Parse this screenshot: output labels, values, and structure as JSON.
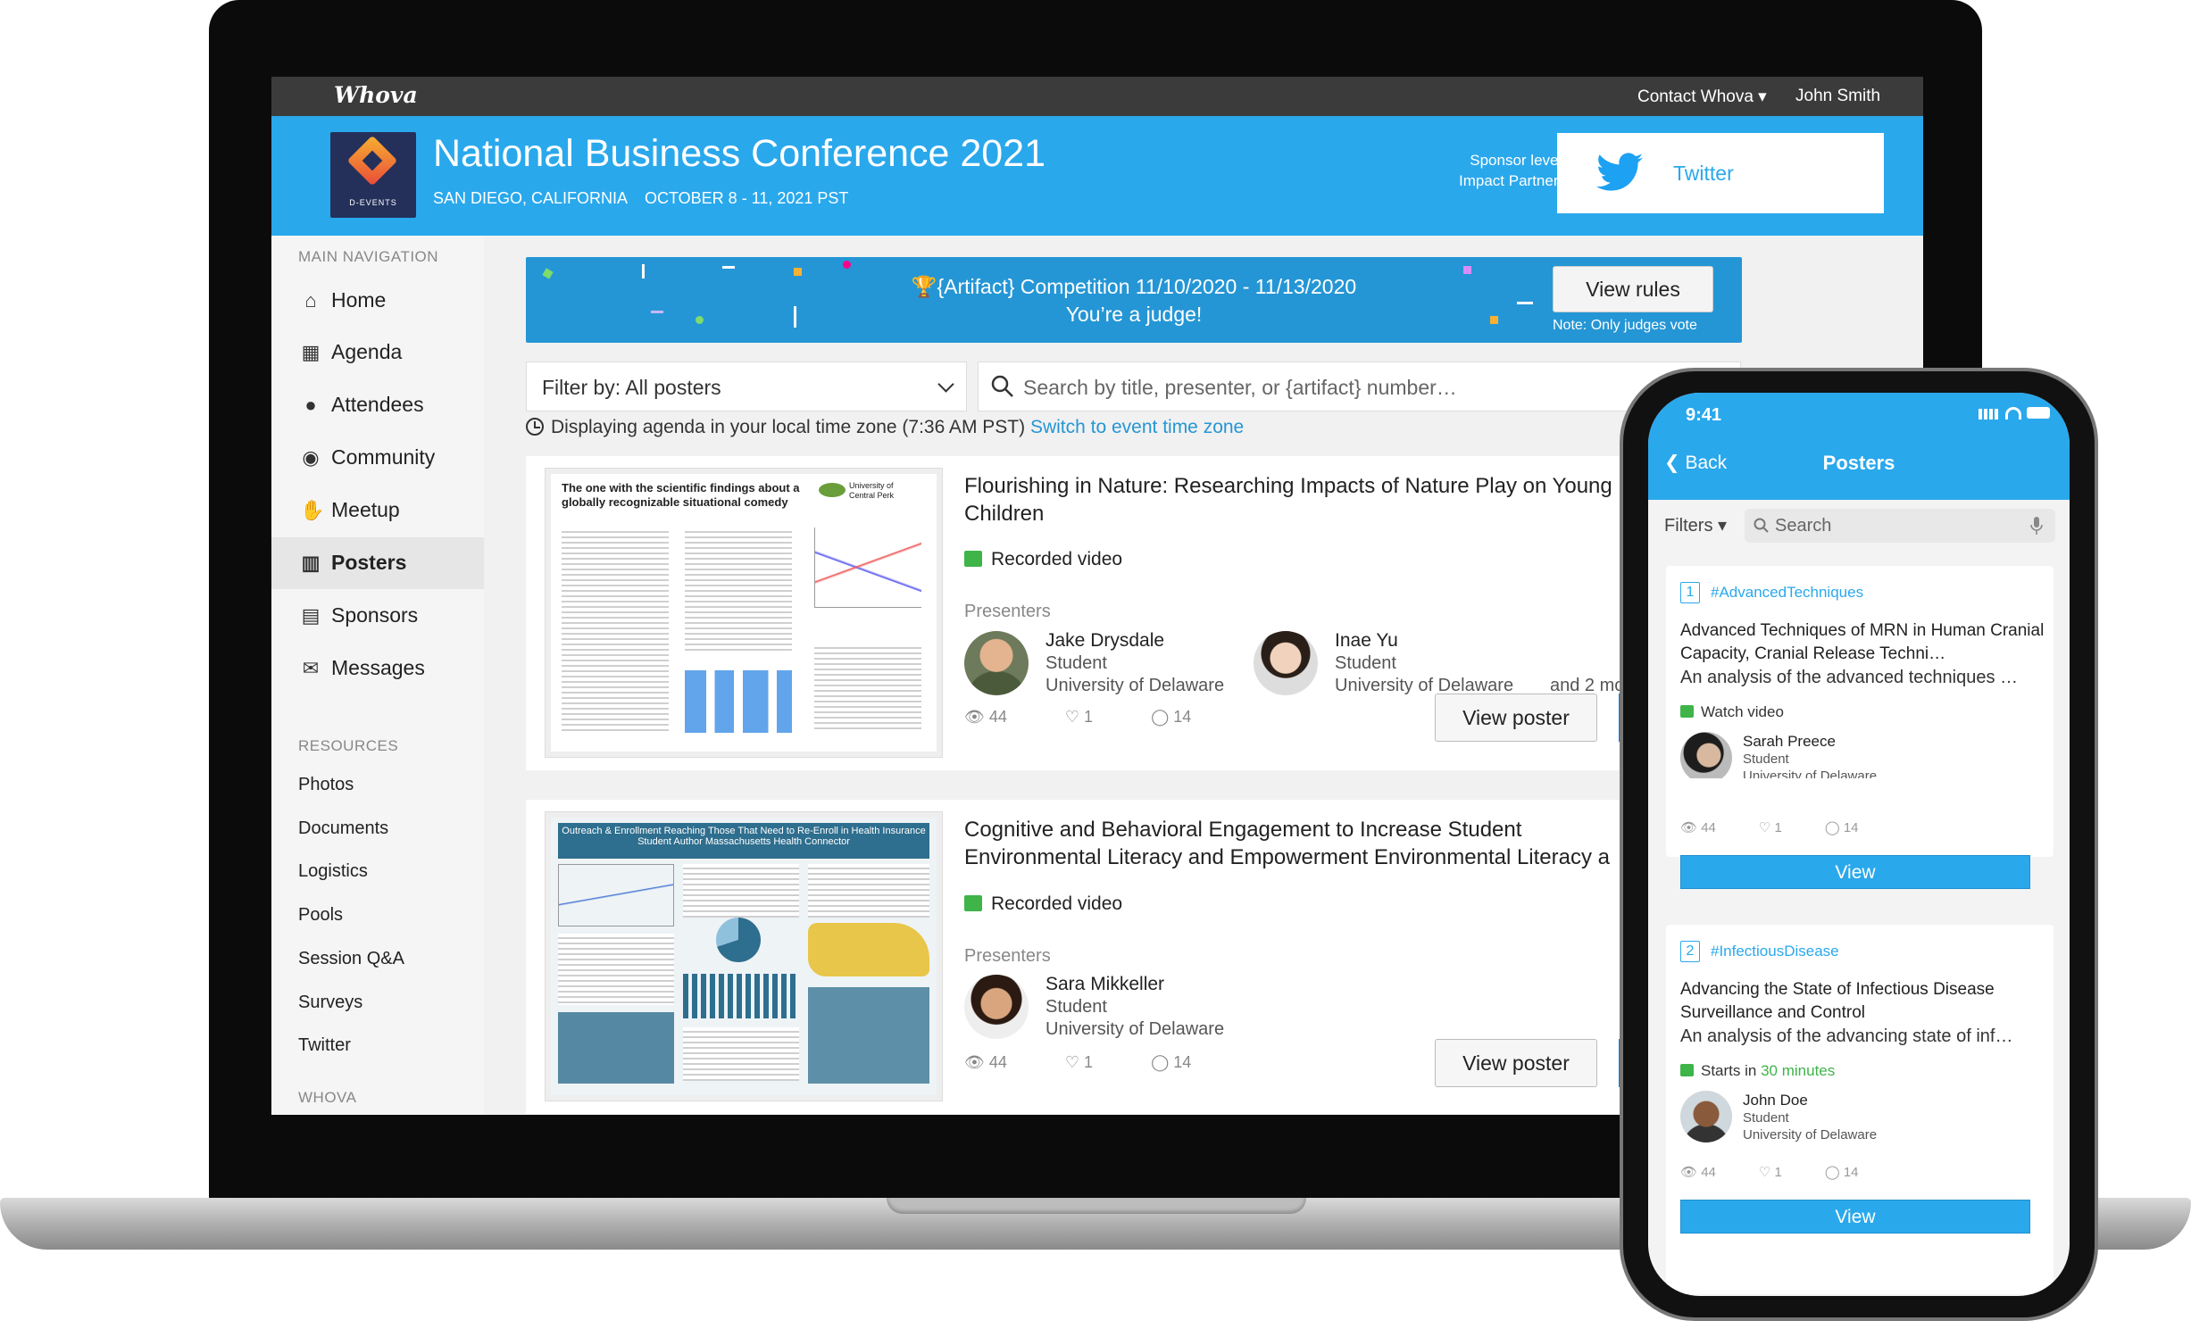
{
  "topbar": {
    "logo": "Whova",
    "contact": "Contact Whova ▾",
    "user": "John Smith"
  },
  "event": {
    "title": "National Business Conference 2021",
    "location": "SAN DIEGO, CALIFORNIA",
    "dates": "OCTOBER 8 - 11, 2021 PST",
    "logo_text": "D-EVENTS",
    "sponsor_label_1": "Sponsor level:",
    "sponsor_label_2": "Impact Partners",
    "sponsor_name": "Twitter"
  },
  "sidebar": {
    "main_heading": "MAIN NAVIGATION",
    "items": [
      {
        "label": "Home",
        "icon": "home-icon"
      },
      {
        "label": "Agenda",
        "icon": "calendar-icon"
      },
      {
        "label": "Attendees",
        "icon": "people-icon"
      },
      {
        "label": "Community",
        "icon": "chat-icon"
      },
      {
        "label": "Meetup",
        "icon": "handshake-icon"
      },
      {
        "label": "Posters",
        "icon": "building-icon"
      },
      {
        "label": "Sponsors",
        "icon": "building-icon"
      },
      {
        "label": "Messages",
        "icon": "envelope-icon"
      }
    ],
    "resources_heading": "RESOURCES",
    "resources": [
      "Photos",
      "Documents",
      "Logistics",
      "Pools",
      "Session Q&A",
      "Surveys",
      "Twitter"
    ],
    "footer_heading": "WHOVA"
  },
  "banner": {
    "line1": "🏆{Artifact} Competition 11/10/2020 - 11/13/2020",
    "line2": "You’re a judge!",
    "button": "View rules",
    "note": "Note: Only judges vote",
    "color": "#2596d5"
  },
  "filter": {
    "label": "Filter by: All posters"
  },
  "search": {
    "placeholder": "Search by title, presenter, or {artifact} number…"
  },
  "timezone": {
    "text": "Displaying agenda in your local time zone (7:36 AM PST)",
    "link": "Switch to event time zone"
  },
  "posters": [
    {
      "title_line1": "Flourishing in Nature: Researching Impacts of Nature Play on Young",
      "title_line2": "Children",
      "media": "Recorded video",
      "presenters_label": "Presenters",
      "presenters": [
        {
          "name": "Jake Drysdale",
          "role": "Student",
          "org": "University of Delaware"
        },
        {
          "name": "Inae Yu",
          "role": "Student",
          "org": "University of Delaware"
        }
      ],
      "more": "and 2 mo",
      "views": "44",
      "likes": "1",
      "comments": "14",
      "button": "View poster",
      "thumb": {
        "title": "The one with the scientific findings about a globally recognizable situational comedy",
        "org": "University of Central Perk"
      }
    },
    {
      "title_line1": "Cognitive and Behavioral Engagement to Increase Student",
      "title_line2": "Environmental Literacy and Empowerment Environmental Literacy a",
      "media": "Recorded video",
      "presenters_label": "Presenters",
      "presenters": [
        {
          "name": "Sara Mikkeller",
          "role": "Student",
          "org": "University of Delaware"
        }
      ],
      "views": "44",
      "likes": "1",
      "comments": "14",
      "button": "View poster",
      "thumb": {
        "title": "Outreach & Enrollment Reaching Those That Need to Re-Enroll in Health Insurance",
        "sub": "Student Author Massachusetts Health Connector"
      }
    }
  ],
  "phone": {
    "time": "9:41",
    "back": "Back",
    "title": "Posters",
    "filters": "Filters ▾",
    "search_placeholder": "Search",
    "cards": [
      {
        "num": "1",
        "tag": "#AdvancedTechniques",
        "title": "Advanced Techniques of MRN in Human Cranial Capacity, Cranial Release Techni…",
        "desc": "An analysis of the advanced techniques …",
        "media": "Watch video",
        "name": "Sarah Preece",
        "role": "Student",
        "org": "University of Delaware",
        "views": "44",
        "likes": "1",
        "comments": "14",
        "button": "View"
      },
      {
        "num": "2",
        "tag": "#InfectiousDisease",
        "title": "Advancing the State of Infectious Disease Surveillance and Control",
        "desc": "An analysis of the advancing state of inf…",
        "media_prefix": "Starts in ",
        "media_time": "30 minutes",
        "name": "John Doe",
        "role": "Student",
        "org": "University of Delaware",
        "views": "44",
        "likes": "1",
        "comments": "14",
        "button": "View"
      }
    ]
  },
  "colors": {
    "brand_blue": "#2aa8ec",
    "green": "#3eb449",
    "dark": "#3b3b3b"
  }
}
